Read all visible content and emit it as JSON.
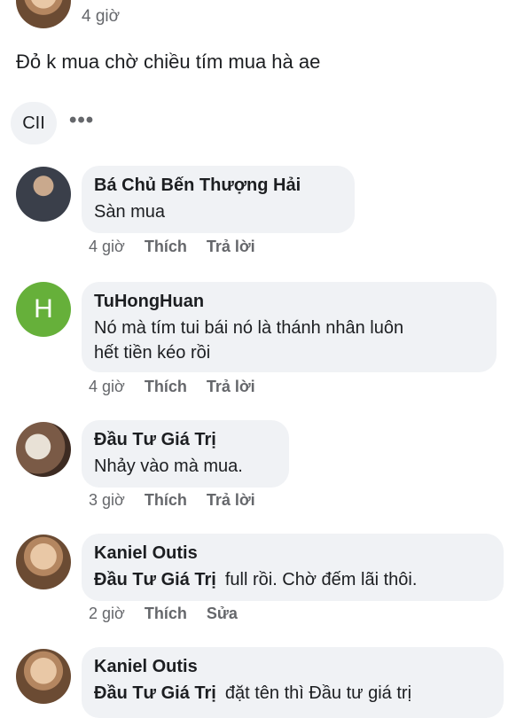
{
  "post": {
    "time": "4 giờ",
    "text": "Đỏ k mua chờ chiều tím mua hà ae",
    "chip_label": "CII",
    "more_icon": "•••"
  },
  "comments": [
    {
      "author": "Bá Chủ Bến Thượng Hải",
      "text": "Sàn mua",
      "time": "4 giờ",
      "like": "Thích",
      "reply": "Trả lời"
    },
    {
      "author": "TuHongHuan",
      "avatar_letter": "H",
      "text_line1": "Nó mà tím tui bái nó là thánh nhân luôn",
      "text_line2": "hết tiền kéo rồi",
      "time": "4 giờ",
      "like": "Thích",
      "reply": "Trả lời"
    },
    {
      "author": "Đầu Tư Giá Trị",
      "text": "Nhảy vào mà mua.",
      "time": "3 giờ",
      "like": "Thích",
      "reply": "Trả lời"
    },
    {
      "author": "Kaniel Outis",
      "mention": "Đầu Tư Giá Trị",
      "text": "full rồi. Chờ đếm lãi thôi.",
      "time": "2 giờ",
      "like": "Thích",
      "edit": "Sửa"
    },
    {
      "author": "Kaniel Outis",
      "mention": "Đầu Tư Giá Trị",
      "text": "đặt tên thì Đầu tư giá trị"
    }
  ]
}
